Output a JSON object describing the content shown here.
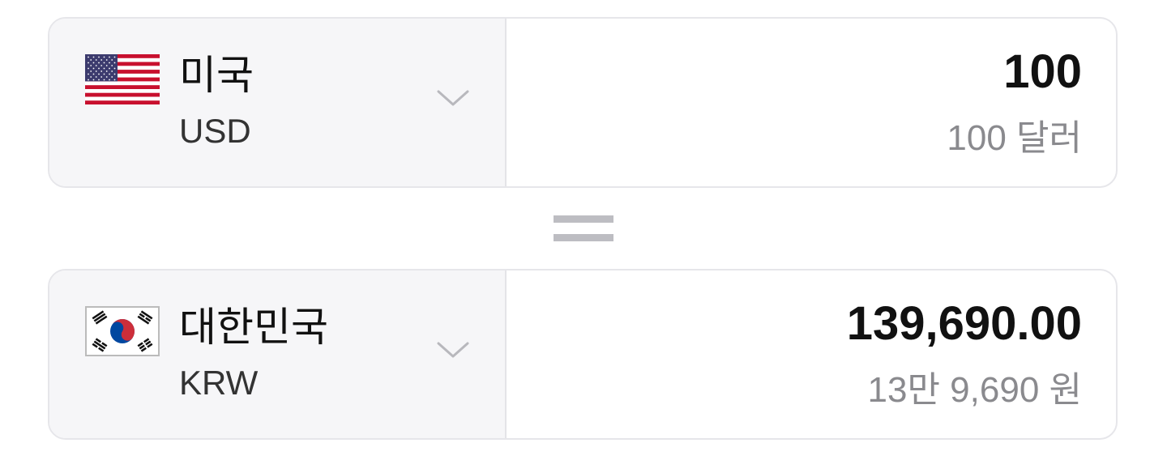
{
  "from": {
    "country": "미국",
    "code": "USD",
    "flag_icon": "us-flag-icon",
    "amount": "100",
    "amount_words": "100 달러"
  },
  "equals_icon": "equals-icon",
  "to": {
    "country": "대한민국",
    "code": "KRW",
    "flag_icon": "kr-flag-icon",
    "amount": "139,690.00",
    "amount_words": "13만 9,690 원"
  },
  "colors": {
    "selector_bg": "#f6f6f8",
    "border": "#e6e6ea",
    "amount_text": "#111111",
    "secondary_text": "#8a8a8e",
    "us_red": "#c8102e",
    "us_blue": "#3c3b6e",
    "kr_red": "#cd2e3a",
    "kr_blue": "#0047a0"
  }
}
